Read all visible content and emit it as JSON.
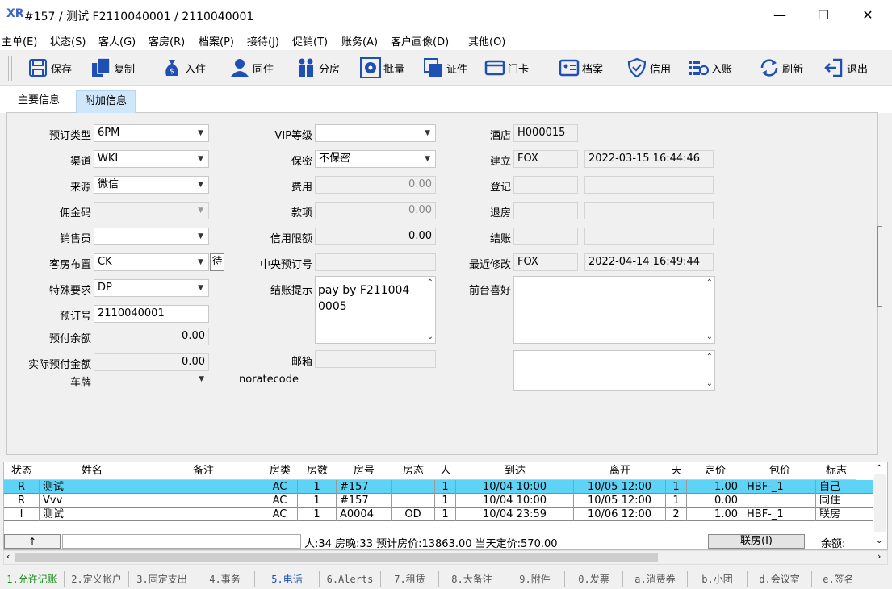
{
  "window": {
    "title": "#157 / 测试 F2110040001 / 2110040001",
    "minimize": "—",
    "maximize": "☐",
    "close": "✕"
  },
  "menu": [
    "主单(E)",
    "状态(S)",
    "客人(G)",
    "客房(R)",
    "档案(P)",
    "接待(J)",
    "促销(T)",
    "账务(A)",
    "客户画像(D)",
    "其他(O)"
  ],
  "toolbar": {
    "save": "保存",
    "copy": "复制",
    "checkin": "入住",
    "share": "同住",
    "split": "分房",
    "batch": "批量",
    "certificate": "证件",
    "keycard": "门卡",
    "profile": "档案",
    "credit": "信用",
    "post": "入账",
    "refresh": "刷新",
    "exit": "退出"
  },
  "tabs": {
    "main": "主要信息",
    "extra": "附加信息"
  },
  "form": {
    "booking_type_label": "预订类型",
    "booking_type": "6PM",
    "channel_label": "渠道",
    "channel": "WKI",
    "source_label": "来源",
    "source": "微信",
    "commission_label": "佣金码",
    "commission": "",
    "salesperson_label": "销售员",
    "salesperson": "",
    "room_layout_label": "客房布置",
    "room_layout": "CK",
    "room_layout_btn": "待",
    "special_label": "特殊要求",
    "special": "DP",
    "booking_no_label": "预订号",
    "booking_no": "2110040001",
    "prepaid_balance_label": "预付余额",
    "prepaid_balance": "0.00",
    "actual_prepaid_label": "实际预付金额",
    "actual_prepaid": "0.00",
    "plate_label": "车牌",
    "plate": "",
    "vip_label": "VIP等级",
    "vip": "",
    "secret_label": "保密",
    "secret": "不保密",
    "fee_label": "费用",
    "fee": "0.00",
    "item_label": "款项",
    "item": "0.00",
    "credit_limit_label": "信用限额",
    "credit_limit": "0.00",
    "central_no_label": "中央预订号",
    "central_no": "",
    "checkout_hint_label": "结账提示",
    "checkout_hint": "pay by F2110040005",
    "email_label": "邮箱",
    "email": "",
    "noratecode": "noratecode",
    "hotel_label": "酒店",
    "hotel": "H000015",
    "created_label": "建立",
    "created_by": "FOX",
    "created_at": "2022-03-15 16:44:46",
    "registered_label": "登记",
    "checkout_label": "退房",
    "settle_label": "结账",
    "modified_label": "最近修改",
    "modified_by": "FOX",
    "modified_at": "2022-04-14 16:49:44",
    "pref_label": "前台喜好",
    "pref": "",
    "note2": ""
  },
  "grid": {
    "headers": [
      "状态",
      "姓名",
      "备注",
      "房类",
      "房数",
      "房号",
      "房态",
      "人",
      "到达",
      "离开",
      "天",
      "定价",
      "包价",
      "标志"
    ],
    "rows": [
      [
        "R",
        "测试",
        "",
        "AC",
        "1",
        "#157",
        "",
        "1",
        "10/04 10:00",
        "10/05 12:00",
        "1",
        "1.00",
        "HBF-_1",
        "自己"
      ],
      [
        "R",
        "Vvv",
        "",
        "AC",
        "1",
        "#157",
        "",
        "1",
        "10/04 10:00",
        "10/05 12:00",
        "1",
        "0.00",
        "",
        "同住"
      ],
      [
        "I",
        "测试",
        "",
        "AC",
        "1",
        "A0004",
        "OD",
        "1",
        "10/04 23:59",
        "10/06 12:00",
        "2",
        "1.00",
        "HBF-_1",
        "联房"
      ]
    ],
    "summary": "人:34  房晚:33  预计房价:13863.00  当天定价:570.00",
    "link_btn": "联房(I)",
    "balance_label": "余额:",
    "up_arrow": "↑"
  },
  "bottom_tabs": [
    "1.允许记账",
    "2.定义帐户",
    "3.固定支出",
    "4.事务",
    "5.电话",
    "6.Alerts",
    "7.租赁",
    "8.大备注",
    "9.附件",
    "0.发票",
    "a.消费券",
    "b.小团",
    "d.会议室",
    "e.签名"
  ],
  "colors": {
    "selected_row": "#5fd3f5",
    "active_tab": "#cfe6fb",
    "accent": "#1f4fb4",
    "green_tab": "#1a8a1a",
    "blue_tab": "#1f4fb4"
  }
}
